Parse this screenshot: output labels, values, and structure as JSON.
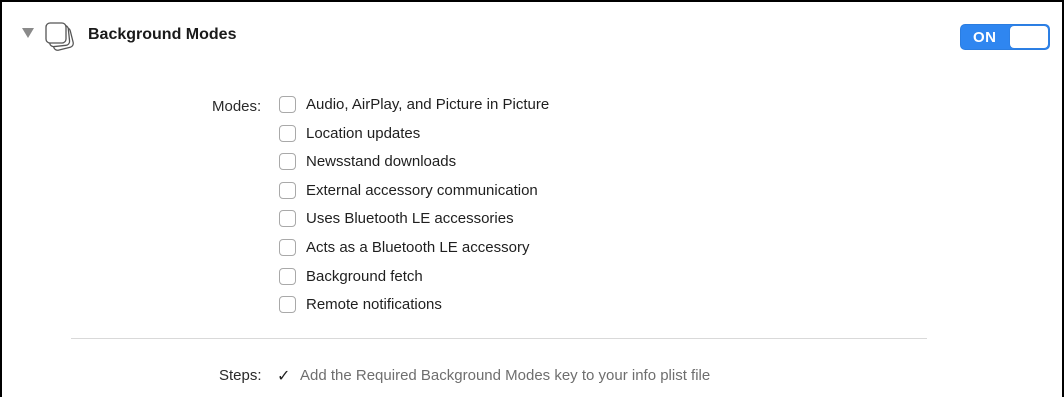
{
  "capability": {
    "title": "Background Modes",
    "icon": "stacked-windows-icon",
    "expanded": true,
    "toggle": {
      "label": "ON",
      "state": "on",
      "accent_color": "#2f86f0"
    }
  },
  "modes": {
    "label": "Modes:",
    "items": [
      {
        "label": "Audio, AirPlay, and Picture in Picture",
        "checked": false
      },
      {
        "label": "Location updates",
        "checked": false
      },
      {
        "label": "Newsstand downloads",
        "checked": false
      },
      {
        "label": "External accessory communication",
        "checked": false
      },
      {
        "label": "Uses Bluetooth LE accessories",
        "checked": false
      },
      {
        "label": "Acts as a Bluetooth LE accessory",
        "checked": false
      },
      {
        "label": "Background fetch",
        "checked": false
      },
      {
        "label": "Remote notifications",
        "checked": false
      }
    ]
  },
  "steps": {
    "label": "Steps:",
    "check_icon": "checkmark-icon",
    "check_glyph": "✓",
    "text": "Add the Required Background Modes key to your info plist file"
  }
}
